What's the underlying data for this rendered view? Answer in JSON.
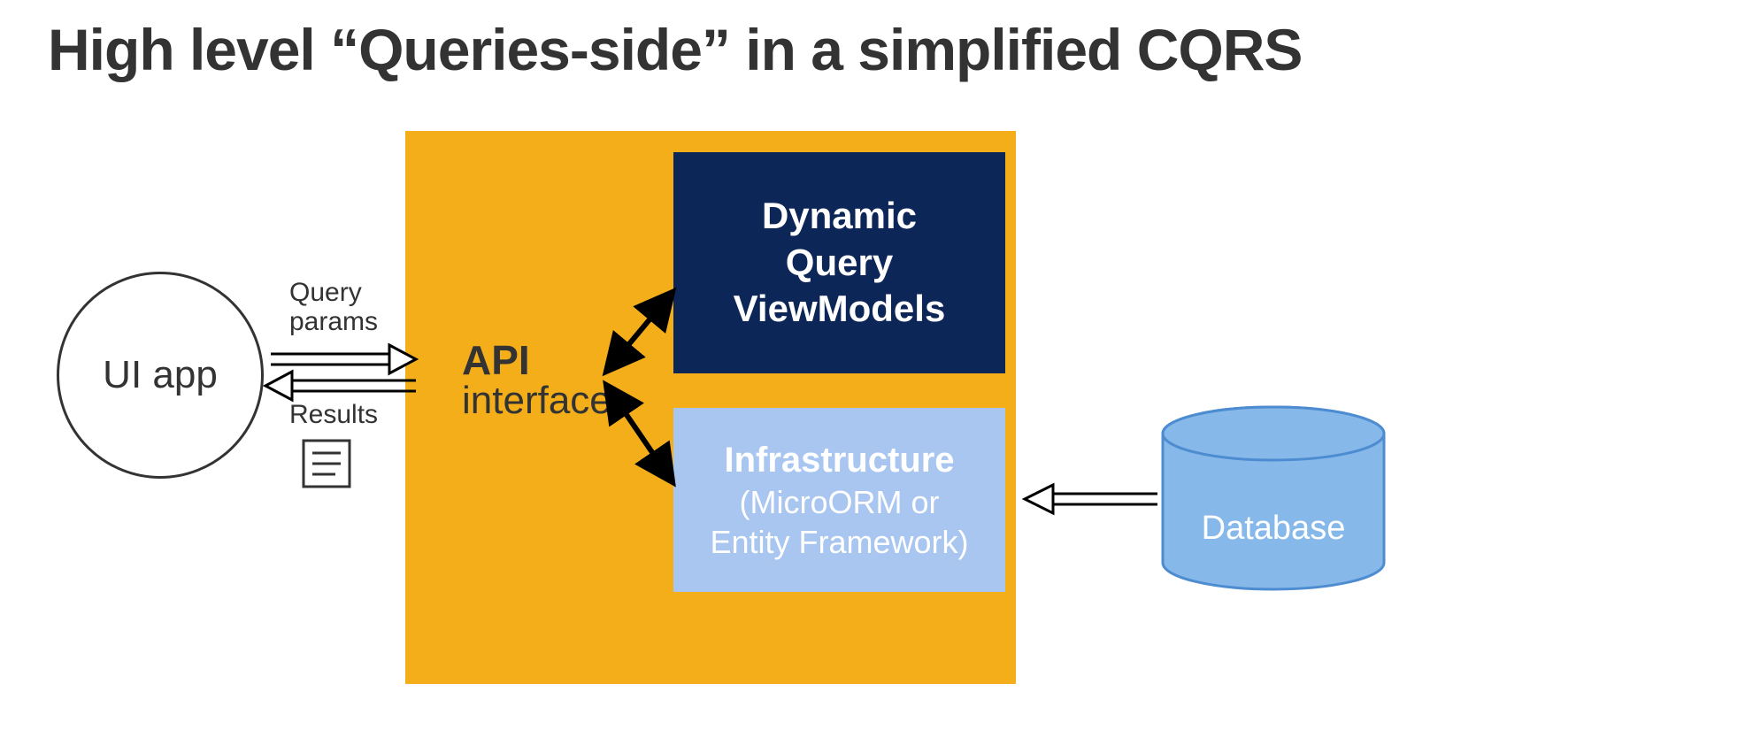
{
  "title": "High level “Queries-side” in a simplified CQRS",
  "ui_app": {
    "label": "UI app"
  },
  "api": {
    "title": "API",
    "subtitle": "interface"
  },
  "viewmodels": {
    "line1": "Dynamic",
    "line2": "Query",
    "line3": "ViewModels"
  },
  "infrastructure": {
    "title": "Infrastructure",
    "sub1": "(MicroORM or",
    "sub2": "Entity Framework)"
  },
  "database": {
    "label": "Database"
  },
  "labels": {
    "query_params_l1": "Query",
    "query_params_l2": "params",
    "results": "Results"
  },
  "colors": {
    "orange": "#f4ae1a",
    "navy": "#0c2658",
    "light": "#a8c6f0",
    "db_fill": "#86b9ea",
    "db_edge": "#4d8cd1",
    "text": "#333333"
  }
}
